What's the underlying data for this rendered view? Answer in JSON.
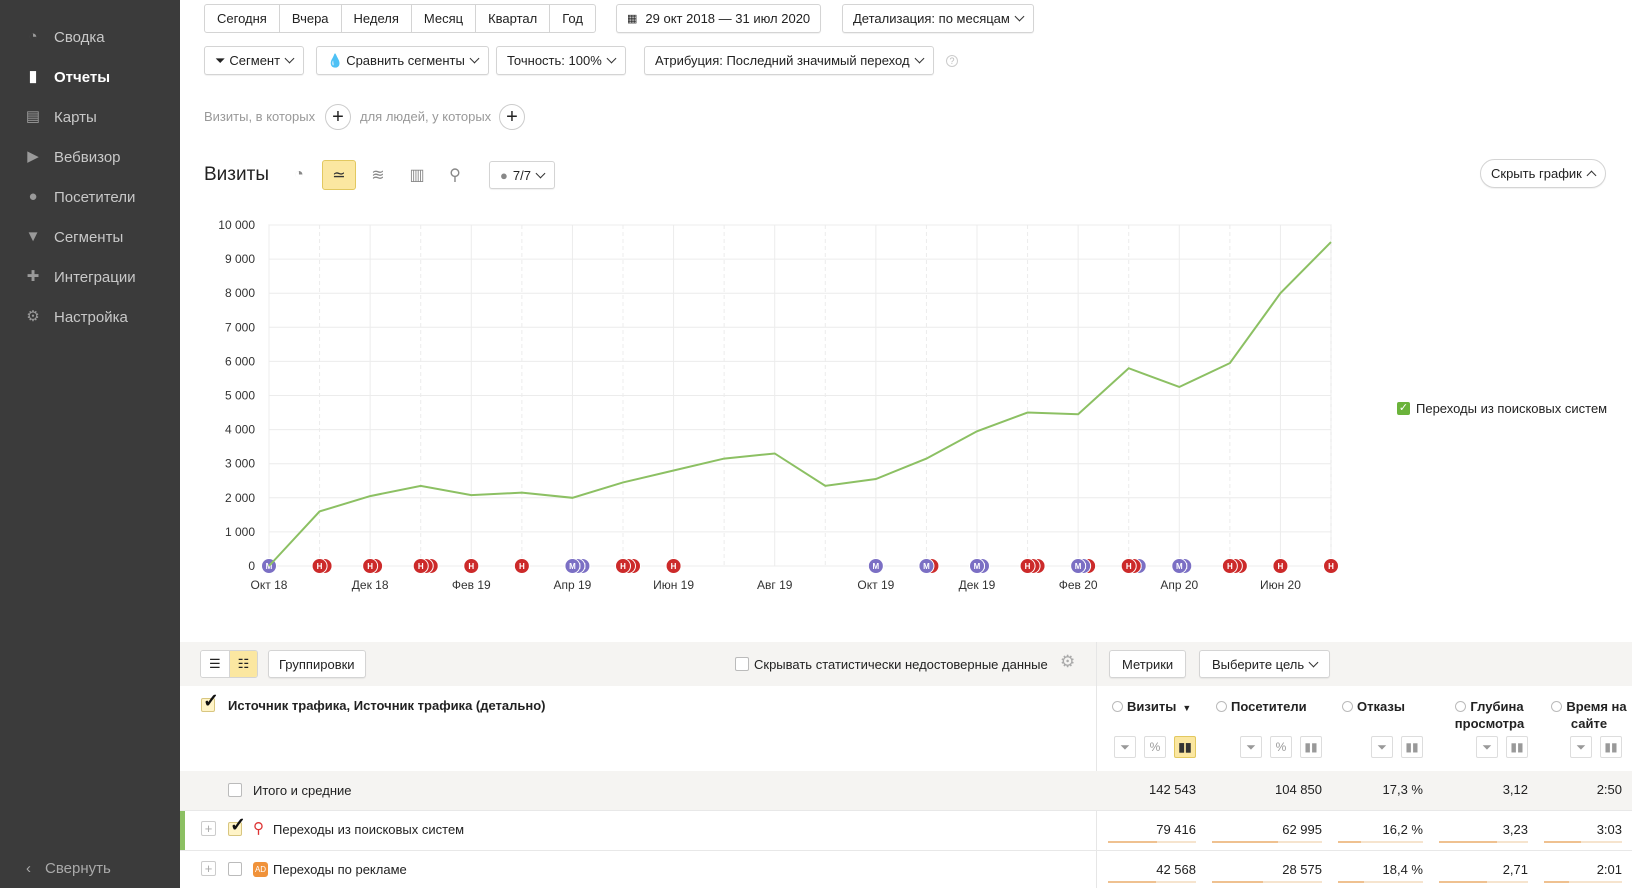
{
  "sidebar": {
    "items": [
      {
        "label": "Сводка",
        "icon": "gauge-icon",
        "glyph": "◔"
      },
      {
        "label": "Отчеты",
        "icon": "bar-chart-icon",
        "glyph": "▮",
        "active": true
      },
      {
        "label": "Карты",
        "icon": "map-icon",
        "glyph": "▤"
      },
      {
        "label": "Вебвизор",
        "icon": "play-icon",
        "glyph": "▶"
      },
      {
        "label": "Посетители",
        "icon": "person-icon",
        "glyph": "●"
      },
      {
        "label": "Сегменты",
        "icon": "funnel-icon",
        "glyph": "▼"
      },
      {
        "label": "Интеграции",
        "icon": "puzzle-icon",
        "glyph": "✚"
      },
      {
        "label": "Настройка",
        "icon": "gear-icon",
        "glyph": "⚙"
      }
    ],
    "collapse": "Свернуть"
  },
  "toolbar": {
    "periods": [
      "Сегодня",
      "Вчера",
      "Неделя",
      "Месяц",
      "Квартал",
      "Год"
    ],
    "date_range": "29 окт 2018 — 31 июл 2020",
    "detail": "Детализация: по месяцам",
    "segment": "Сегмент",
    "compare": "Сравнить сегменты",
    "accuracy": "Точность: 100%",
    "attribution": "Атрибуция: Последний значимый переход"
  },
  "filters": {
    "visits_where": "Визиты, в которых",
    "people_where": "для людей, у которых"
  },
  "chart_header": {
    "title": "Визиты",
    "annotations_count": "7/7",
    "hide_chart": "Скрыть график"
  },
  "chart_data": {
    "type": "line",
    "ylim": [
      0,
      10000
    ],
    "yticks": [
      "0",
      "1 000",
      "2 000",
      "3 000",
      "4 000",
      "5 000",
      "6 000",
      "7 000",
      "8 000",
      "9 000",
      "10 000"
    ],
    "x": [
      "Окт 18",
      "Ноя 18",
      "Дек 18",
      "Янв 19",
      "Фев 19",
      "Мар 19",
      "Апр 19",
      "Май 19",
      "Июн 19",
      "Июл 19",
      "Авг 19",
      "Сен 19",
      "Окт 19",
      "Ноя 19",
      "Дек 19",
      "Янв 20",
      "Фев 20",
      "Мар 20",
      "Апр 20",
      "Май 20",
      "Июн 20",
      "Июл 20"
    ],
    "xtick_labels": [
      "Окт 18",
      "Дек 18",
      "Фев 19",
      "Апр 19",
      "Июн 19",
      "Авг 19",
      "Окт 19",
      "Дек 19",
      "Фев 20",
      "Апр 20",
      "Июн 20"
    ],
    "series": [
      {
        "name": "Переходы из поисковых систем",
        "color": "#8cc063",
        "values": [
          0,
          1600,
          2050,
          2350,
          2080,
          2150,
          2000,
          2450,
          2800,
          3150,
          3300,
          2350,
          2550,
          3150,
          3950,
          4500,
          4450,
          5800,
          5250,
          5950,
          8000,
          9500
        ]
      }
    ],
    "annotations": [
      [
        "М"
      ],
      [
        "Н",
        "Н"
      ],
      [
        "Н",
        "Н"
      ],
      [
        "Н",
        "Н",
        "Н"
      ],
      [
        "Н"
      ],
      [
        "Н"
      ],
      [
        "М",
        "М",
        "М"
      ],
      [
        "Н",
        "Н",
        "Н"
      ],
      [
        "Н"
      ],
      [],
      [],
      [],
      [
        "М"
      ],
      [
        "М",
        "Н"
      ],
      [
        "М",
        "М"
      ],
      [
        "Н",
        "Н",
        "Н"
      ],
      [
        "М",
        "М",
        "Н"
      ],
      [
        "Н",
        "Н",
        "М"
      ],
      [
        "М",
        "М"
      ],
      [
        "Н",
        "Н",
        "Н"
      ],
      [
        "Н"
      ],
      [
        "Н"
      ]
    ],
    "annotation_colors": {
      "М": "#7b6fc4",
      "Н": "#cc2a2a"
    },
    "legend": "right",
    "grid": true
  },
  "table": {
    "groupings": "Группировки",
    "hide_unreliable": "Скрывать статистически недостоверные данные",
    "metrics": "Метрики",
    "goal": "Выберите цель",
    "dimension_header": "Источник трафика, Источник трафика (детально)",
    "columns": [
      "Визиты",
      "Посетители",
      "Отказы",
      "Глубина просмотра",
      "Время на сайте"
    ],
    "sort_marker": "▼",
    "total": {
      "label": "Итого и средние",
      "values": [
        "142 543",
        "104 850",
        "17,3 %",
        "3,12",
        "2:50"
      ]
    },
    "rows": [
      {
        "label": "Переходы из поисковых систем",
        "icon": "search-icon",
        "checked": true,
        "values": [
          "79 416",
          "62 995",
          "16,2 %",
          "3,23",
          "3:03"
        ],
        "shares": [
          0.56,
          0.6,
          0.27,
          0.65,
          0.48
        ]
      },
      {
        "label": "Переходы по рекламе",
        "icon": "ad-icon",
        "badge": "AD",
        "checked": false,
        "values": [
          "42 568",
          "28 575",
          "18,4 %",
          "2,71",
          "2:01"
        ],
        "shares": [
          0.54,
          0.46,
          0.31,
          0.54,
          0.32
        ]
      }
    ]
  }
}
